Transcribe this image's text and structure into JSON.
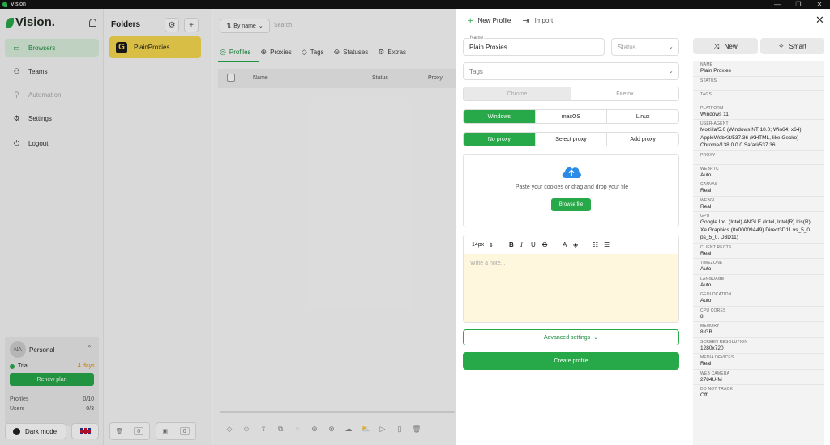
{
  "window": {
    "title": "Vision"
  },
  "brand": {
    "name": "Vision."
  },
  "nav": [
    {
      "label": "Browsers",
      "icon": "browser-icon"
    },
    {
      "label": "Teams",
      "icon": "users-icon"
    },
    {
      "label": "Automation",
      "icon": "automation-icon"
    },
    {
      "label": "Settings",
      "icon": "gear-icon"
    },
    {
      "label": "Logout",
      "icon": "power-icon"
    }
  ],
  "workspace": {
    "initials": "NA",
    "name": "Personal",
    "trial_label": "Trial",
    "trial_days": "4 days",
    "renew_label": "Renew plan",
    "profiles_label": "Profiles",
    "profiles_value": "0/10",
    "users_label": "Users",
    "users_value": "0/3"
  },
  "darkmode": {
    "label": "Dark mode"
  },
  "folders": {
    "title": "Folders",
    "items": [
      {
        "initial": "G",
        "label": "PlainProxies"
      }
    ],
    "bottom_counts": [
      "0",
      "0"
    ]
  },
  "main": {
    "sort_label": "By name",
    "search_placeholder": "Search",
    "tabs": [
      "Profiles",
      "Proxies",
      "Tags",
      "Statuses",
      "Extras"
    ],
    "columns": [
      "Name",
      "Status",
      "Proxy"
    ]
  },
  "panel": {
    "tabs": [
      "New Profile",
      "Import"
    ],
    "name_label": "Name",
    "name_value": "Plain Proxies",
    "status_placeholder": "Status",
    "tags_placeholder": "Tags",
    "browsers": [
      "Chrome",
      "Firefox"
    ],
    "os_options": [
      "Windows",
      "macOS",
      "Linux"
    ],
    "proxy_options": [
      "No proxy",
      "Select proxy",
      "Add proxy"
    ],
    "dropzone_text": "Paste your cookies or drag and drop your file",
    "browse_label": "Browse file",
    "font_size": "14px",
    "note_placeholder": "Write a note...",
    "advanced_label": "Advanced settings",
    "create_label": "Create profile",
    "new_label": "New",
    "smart_label": "Smart"
  },
  "summary": [
    {
      "k": "Name",
      "v": "Plain Proxies"
    },
    {
      "k": "Status",
      "v": ""
    },
    {
      "k": "Tags",
      "v": ""
    },
    {
      "k": "Platform",
      "v": "Windows 11"
    },
    {
      "k": "User-Agent",
      "v": "Mozilla/5.0 (Windows NT 10.0; Win64; x64) AppleWebKit/537.36 (KHTML, like Gecko) Chrome/138.0.0.0 Safari/537.36"
    },
    {
      "k": "Proxy",
      "v": ""
    },
    {
      "k": "WebRTC",
      "v": "Auto"
    },
    {
      "k": "Canvas",
      "v": "Real"
    },
    {
      "k": "WebGL",
      "v": "Real"
    },
    {
      "k": "GPU",
      "v": "Google Inc. (Intel) ANGLE (Intel, Intel(R) Iris(R) Xe Graphics (0x00009A49) Direct3D11 vs_5_0 ps_5_0, D3D11)"
    },
    {
      "k": "Client Rects",
      "v": "Real"
    },
    {
      "k": "Timezone",
      "v": "Auto"
    },
    {
      "k": "Language",
      "v": "Auto"
    },
    {
      "k": "Geolocation",
      "v": "Auto"
    },
    {
      "k": "CPU Cores",
      "v": "8"
    },
    {
      "k": "Memory",
      "v": "8 GB"
    },
    {
      "k": "Screen Resolution",
      "v": "1280x720"
    },
    {
      "k": "Media Devices",
      "v": "Real"
    },
    {
      "k": "Web Camera",
      "v": "2784U-M"
    },
    {
      "k": "Do Not Track",
      "v": "Off"
    }
  ],
  "colors": {
    "accent": "#27a849",
    "folder": "#f7d94f",
    "note_bg": "#fff7dd"
  }
}
